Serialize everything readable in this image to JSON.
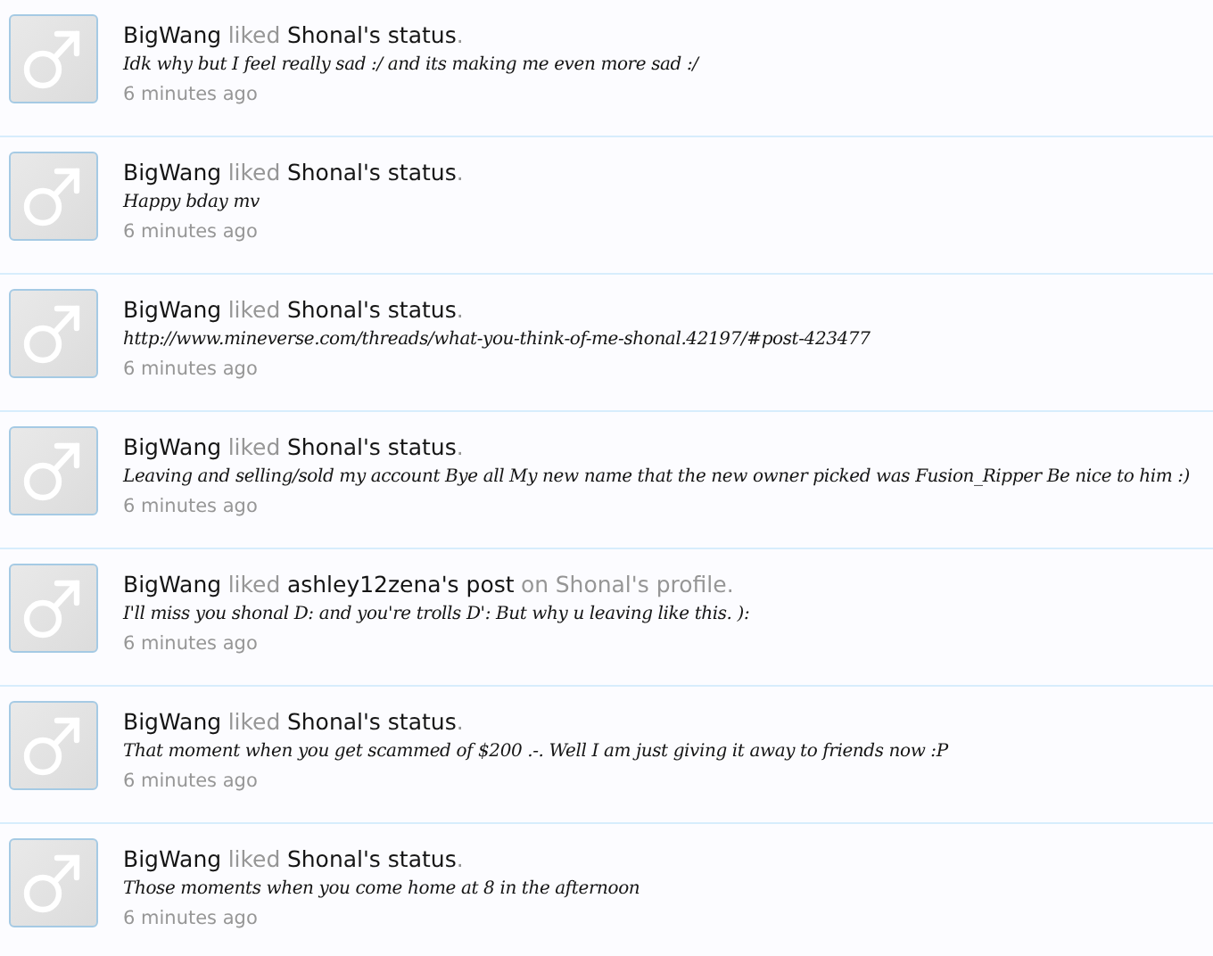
{
  "activity": [
    {
      "header": [
        {
          "kind": "link",
          "text": "BigWang"
        },
        {
          "kind": "plain",
          "text": "liked"
        },
        {
          "kind": "link",
          "text": "Shonal's status"
        },
        {
          "kind": "end",
          "text": "."
        }
      ],
      "snippet": "Idk why but I feel really sad :/ and its making me even more sad :/",
      "time": "6 minutes ago"
    },
    {
      "header": [
        {
          "kind": "link",
          "text": "BigWang"
        },
        {
          "kind": "plain",
          "text": "liked"
        },
        {
          "kind": "link",
          "text": "Shonal's status"
        },
        {
          "kind": "end",
          "text": "."
        }
      ],
      "snippet": "Happy bday mv",
      "time": "6 minutes ago"
    },
    {
      "header": [
        {
          "kind": "link",
          "text": "BigWang"
        },
        {
          "kind": "plain",
          "text": "liked"
        },
        {
          "kind": "link",
          "text": "Shonal's status"
        },
        {
          "kind": "end",
          "text": "."
        }
      ],
      "snippet": "http://www.mineverse.com/threads/what-you-think-of-me-shonal.42197/#post-423477",
      "time": "6 minutes ago"
    },
    {
      "header": [
        {
          "kind": "link",
          "text": "BigWang"
        },
        {
          "kind": "plain",
          "text": "liked"
        },
        {
          "kind": "link",
          "text": "Shonal's status"
        },
        {
          "kind": "end",
          "text": "."
        }
      ],
      "snippet": "Leaving and selling/sold my account Bye all My new name that the new owner picked was Fusion_Ripper Be nice to him :)",
      "time": "6 minutes ago"
    },
    {
      "header": [
        {
          "kind": "link",
          "text": "BigWang"
        },
        {
          "kind": "plain",
          "text": "liked"
        },
        {
          "kind": "link",
          "text": "ashley12zena's post"
        },
        {
          "kind": "plain",
          "text": "on"
        },
        {
          "kind": "plain",
          "text": "Shonal's profile"
        },
        {
          "kind": "end",
          "text": "."
        }
      ],
      "snippet": "I'll miss you shonal D: and you're trolls D': But why u leaving like this. ):",
      "time": "6 minutes ago"
    },
    {
      "header": [
        {
          "kind": "link",
          "text": "BigWang"
        },
        {
          "kind": "plain",
          "text": "liked"
        },
        {
          "kind": "link",
          "text": "Shonal's status"
        },
        {
          "kind": "end",
          "text": "."
        }
      ],
      "snippet": "That moment when you get scammed of $200 .-. Well I am just giving it away to friends now :P",
      "time": "6 minutes ago"
    },
    {
      "header": [
        {
          "kind": "link",
          "text": "BigWang"
        },
        {
          "kind": "plain",
          "text": "liked"
        },
        {
          "kind": "link",
          "text": "Shonal's status"
        },
        {
          "kind": "end",
          "text": "."
        }
      ],
      "snippet": "Those moments when you come home at 8 in the afternoon",
      "time": "6 minutes ago"
    }
  ]
}
